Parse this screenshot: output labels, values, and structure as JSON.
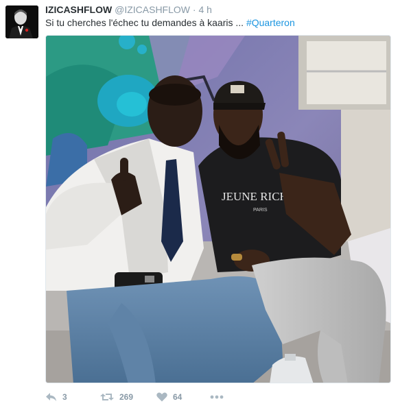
{
  "tweet": {
    "display_name": "IZICASHFLOW",
    "handle": "@IZICASHFLOW",
    "separator": "·",
    "time": "4 h",
    "text": "Si tu cherches l'échec tu demandes à kaaris ...",
    "hashtag": "#Quarteron",
    "media": {
      "shirt_text_line1": "JEUNE RICHE",
      "shirt_text_line2": "PARIS"
    }
  },
  "actions": {
    "reply_count": "3",
    "retweet_count": "269",
    "like_count": "64"
  },
  "colors": {
    "hashtag": "#1b95e0",
    "meta": "#8899a6",
    "text": "#292f33",
    "border": "#e1e8ed"
  },
  "icons": [
    "reply-icon",
    "retweet-icon",
    "like-icon",
    "more-icon"
  ]
}
